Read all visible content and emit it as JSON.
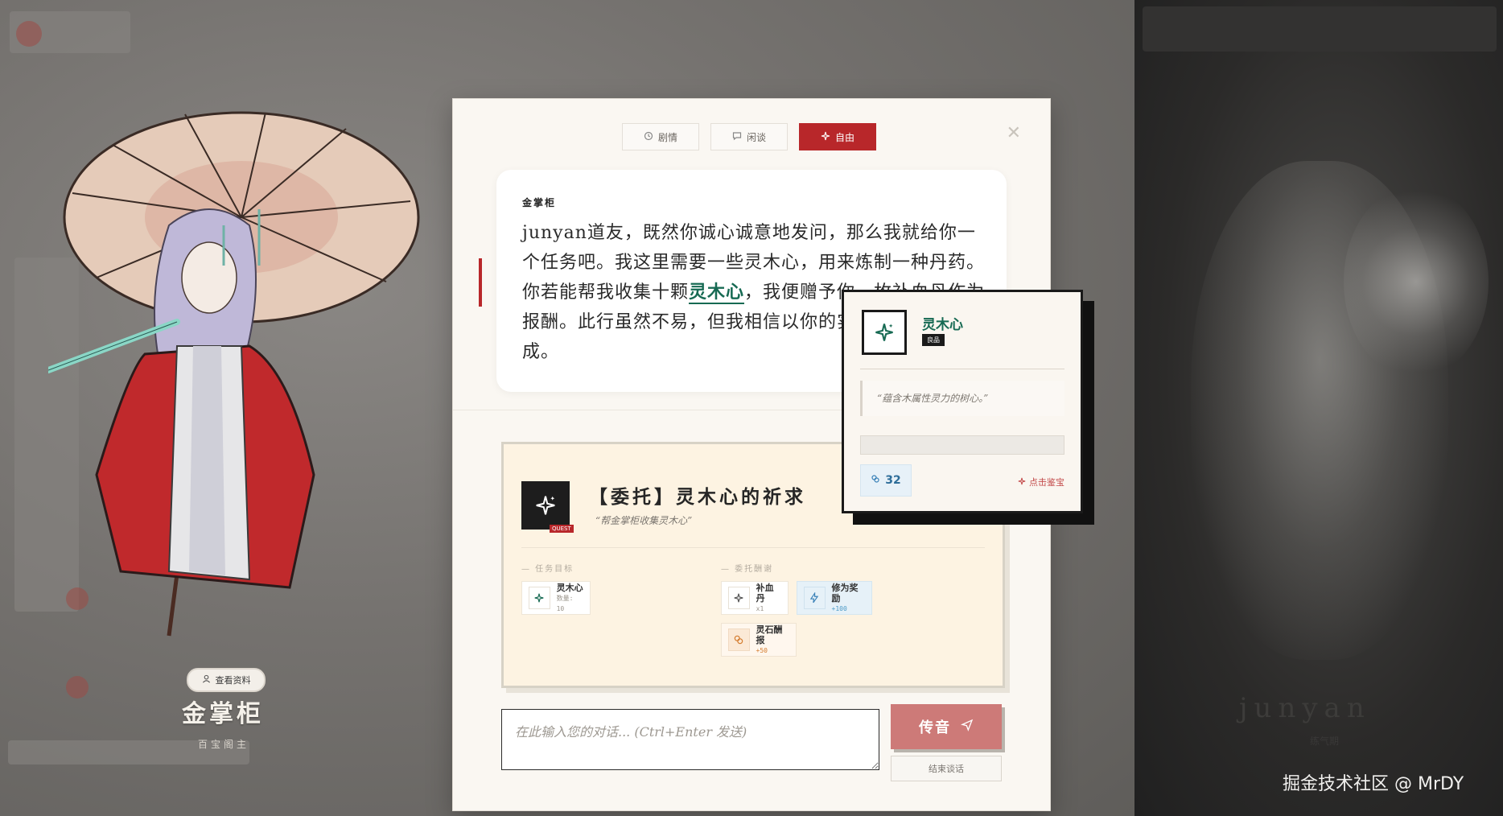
{
  "npc": {
    "view_profile_label": "查看资料",
    "name": "金掌柜",
    "title": "百宝阁主"
  },
  "player": {
    "name": "junyan",
    "subtitle": "练气期"
  },
  "tabs": [
    {
      "label": "剧情",
      "icon": "history-icon"
    },
    {
      "label": "闲谈",
      "icon": "chat-bubble-icon"
    },
    {
      "label": "自由",
      "icon": "sparkle-icon",
      "active": true
    }
  ],
  "dialog": {
    "speaker": "金掌柜",
    "text_part1": "junyan道友，既然你诚心诚意地发问，那么我就给你一个任务吧。我这里需要一些灵木心，用来炼制一种丹药。你若能帮我收集十颗",
    "keyword1": "灵木心",
    "text_part2": "，我便赠予你一枚",
    "keyword2": "补血丹",
    "text_part3": "作为报酬。此行虽然不易，但我相信以你的实力，定能轻松完成。"
  },
  "quest": {
    "badge": "QUEST",
    "title": "【委托】灵木心的祈求",
    "subtitle": "“帮金掌柜收集灵木心”",
    "objective_label": "— 任务目标",
    "reward_label": "— 委托酬谢",
    "objectives": [
      {
        "name": "灵木心",
        "sub": "数量: 10"
      }
    ],
    "rewards": [
      {
        "name": "补血丹",
        "sub": "x1",
        "style": "plain"
      },
      {
        "name": "修为奖励",
        "sub": "+100",
        "style": "blue"
      },
      {
        "name": "灵石酬报",
        "sub": "+50",
        "style": "orange"
      }
    ]
  },
  "input": {
    "placeholder": "在此输入您的对话... (Ctrl+Enter 发送)",
    "value": ""
  },
  "buttons": {
    "send": "传音",
    "end": "结束谈话"
  },
  "tooltip": {
    "name": "灵木心",
    "rarity": "良品",
    "description": "“蕴含木属性灵力的树心。”",
    "price": "32",
    "identify": "点击鉴宝"
  },
  "watermark": "掘金技术社区 @ MrDY",
  "colors": {
    "accent_red": "#b8272a",
    "item_green": "#176a53",
    "send_button": "#cd7a78"
  }
}
